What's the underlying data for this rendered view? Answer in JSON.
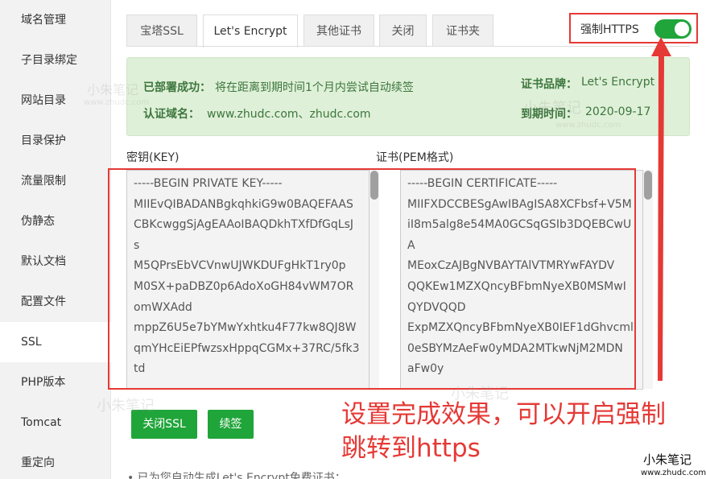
{
  "sidebar": {
    "items": [
      {
        "label": "域名管理"
      },
      {
        "label": "子目录绑定"
      },
      {
        "label": "网站目录"
      },
      {
        "label": "目录保护"
      },
      {
        "label": "流量限制"
      },
      {
        "label": "伪静态"
      },
      {
        "label": "默认文档"
      },
      {
        "label": "配置文件"
      },
      {
        "label": "SSL",
        "active": true
      },
      {
        "label": "PHP版本"
      },
      {
        "label": "Tomcat"
      },
      {
        "label": "重定向"
      }
    ]
  },
  "tabs": [
    {
      "label": "宝塔SSL"
    },
    {
      "label": "Let's Encrypt",
      "active": true
    },
    {
      "label": "其他证书"
    },
    {
      "label": "关闭"
    },
    {
      "label": "证书夹"
    }
  ],
  "force_https": {
    "label": "强制HTTPS",
    "enabled": true,
    "toggle_color": "#20a53a"
  },
  "info": {
    "deployed_label": "已部署成功：",
    "deployed_text": "将在距离到期时间1个月内尝试自动续签",
    "domain_label": "认证域名：",
    "domain_value": "www.zhudc.com、zhudc.com",
    "brand_label": "证书品牌：",
    "brand_value": "Let's Encrypt",
    "expiry_label": "到期时间：",
    "expiry_value": "2020-09-17"
  },
  "key": {
    "label": "密钥(KEY)",
    "lines": [
      "-----BEGIN PRIVATE KEY-----",
      "MIIEvQIBADANBgkqhkiG9w0BAQEFAAS",
      "CBKcwggSjAgEAAoIBAQDkhTXfDfGqLsJ",
      "s",
      "M5QPrsEbVCVnwUJWKDUFgHkT1ry0p",
      "M0SX+paDBZ0p6AdoXoGH84vWM7OR",
      "omWXAdd",
      "mppZ6U5e7bYMwYxhtku4F77kw8QJ8W",
      "qmYHcEiEPfwzsxHppqCGMx+37RC/5fk3",
      "td"
    ]
  },
  "cert": {
    "label": "证书(PEM格式)",
    "lines": [
      "-----BEGIN CERTIFICATE-----",
      "MIIFXDCCBESgAwIBAgISA8XCFbsf+V5M",
      "iI8m5alg8e54MA0GCSqGSIb3DQEBCwU",
      "A",
      "MEoxCzAJBgNVBAYTAlVTMRYwFAYDV",
      "QQKEw1MZXQncyBFbmNyeXB0MSMwI",
      "QYDVQQD",
      "ExpMZXQncyBFbmNyeXB0IEF1dGhvcml",
      "0eSBYMzAeFw0yMDA2MTkwNjM2MDN",
      "aFw0y"
    ]
  },
  "buttons": {
    "close_ssl": "关闭SSL",
    "renew": "续签"
  },
  "bullet_text": "已为您自动生成Let's Encrypt免费证书；",
  "annotation": {
    "line1": "设置完成效果，可以开启强制",
    "line2": "跳转到https",
    "color": "#e53935"
  },
  "watermark": {
    "brand": "小朱笔记",
    "url": "www.zhudc.com"
  }
}
